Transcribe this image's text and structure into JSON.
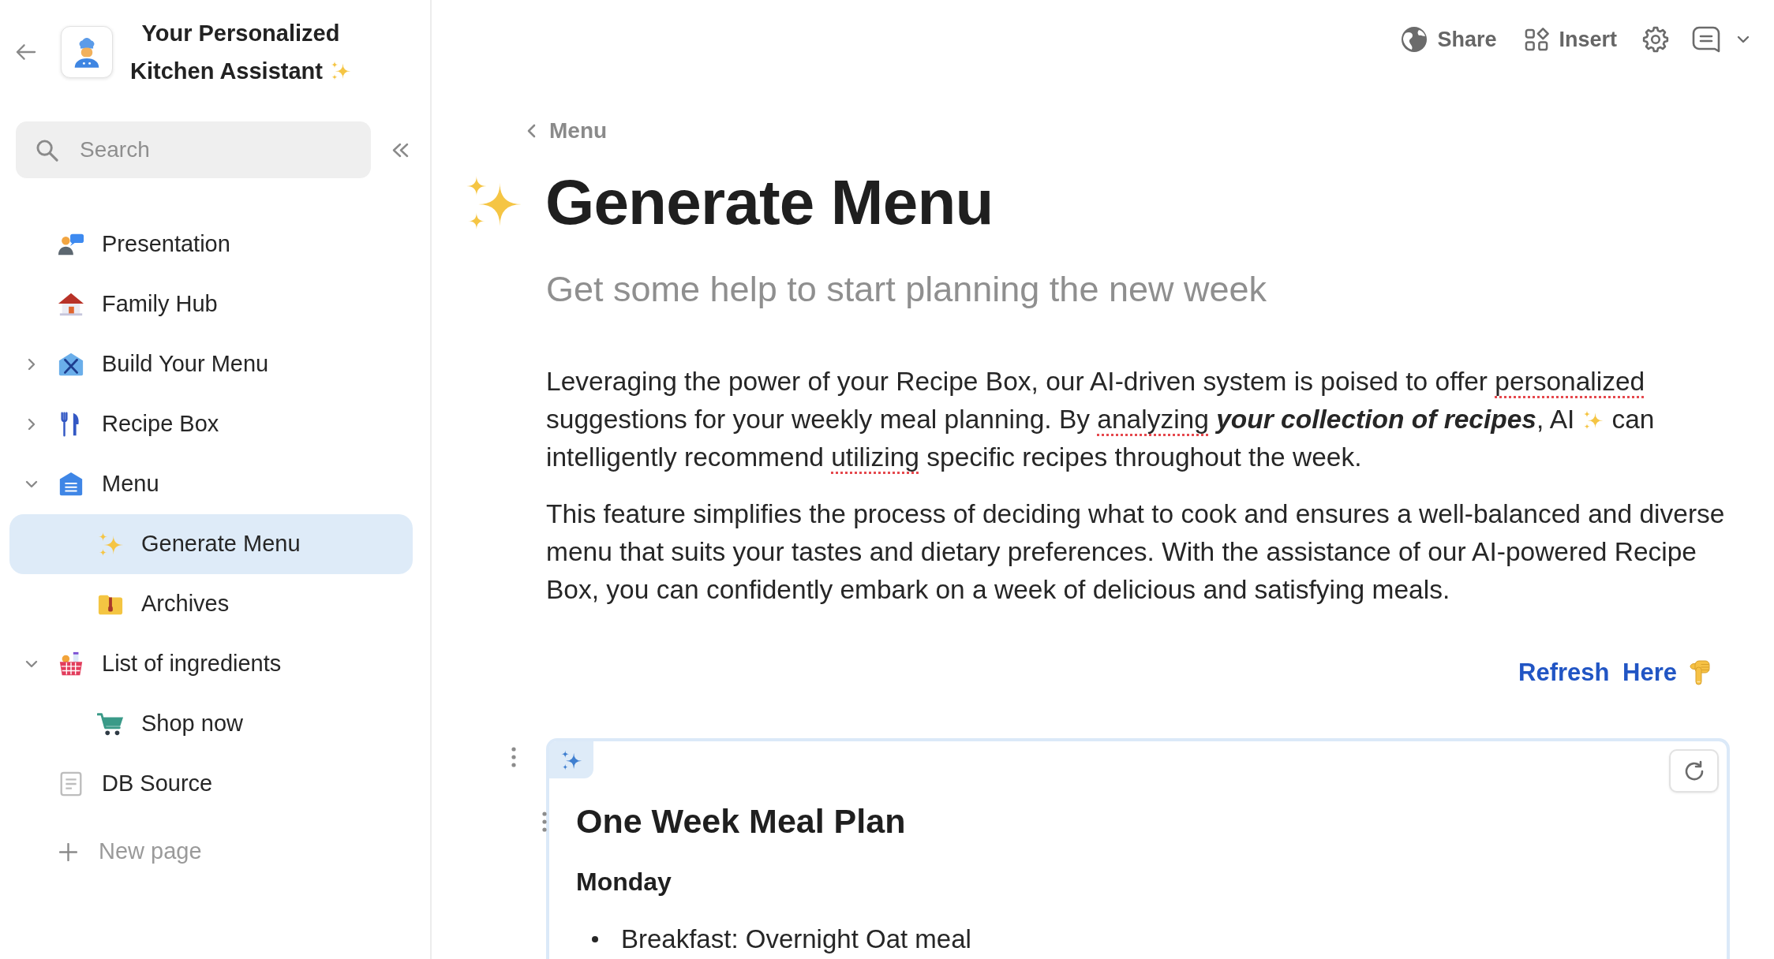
{
  "sidebar": {
    "title": "Your Personalized Kitchen Assistant",
    "search": {
      "placeholder": "Search"
    },
    "pages": [
      {
        "label": "Presentation",
        "selected": false
      },
      {
        "label": "Family Hub",
        "selected": false
      },
      {
        "label": "Build Your Menu",
        "expanded": false,
        "selected": false
      },
      {
        "label": "Recipe Box",
        "expanded": false,
        "selected": false
      },
      {
        "label": "Menu",
        "expanded": true,
        "selected": false,
        "children": [
          {
            "label": "Generate Menu",
            "selected": true
          },
          {
            "label": "Archives",
            "selected": false
          }
        ]
      },
      {
        "label": "List of ingredients",
        "expanded": true,
        "selected": false,
        "children": [
          {
            "label": "Shop now",
            "selected": false
          }
        ]
      },
      {
        "label": "DB Source",
        "selected": false
      }
    ],
    "new_page": "New page"
  },
  "toolbar": [
    {
      "label": "Share"
    },
    {
      "label": "Insert"
    }
  ],
  "breadcrumb": "Menu",
  "title": "Generate Menu",
  "subtitle": "Get some help to start planning the new week",
  "paragraphs": [
    {
      "segments": [
        [
          {
            "text": "Leveraging the power of your Recipe Box, our AI-driven system is poised to offer ",
            "emphasis": false,
            "spelling_error": false
          },
          {
            "text": "personalized",
            "emphasis": false,
            "spelling_error": true
          },
          {
            "text": " suggestions for your weekly meal planning. By ",
            "emphasis": false,
            "spelling_error": false
          },
          {
            "text": "analyzing",
            "emphasis": false,
            "spelling_error": true
          },
          {
            "text": " your collection of recipes",
            "emphasis": true,
            "spelling_error": false
          },
          {
            "text": ", AI",
            "emphasis": false,
            "spelling_error": false
          }
        ],
        [
          {
            "text": "can intelligently recommend ",
            "emphasis": false,
            "spelling_error": false
          },
          {
            "text": "utilizing",
            "emphasis": false,
            "spelling_error": true
          },
          {
            "text": " specific recipes throughout the week.",
            "emphasis": false,
            "spelling_error": false
          }
        ]
      ]
    },
    {
      "segments": [
        [
          {
            "text": "This feature simplifies the process of deciding what to cook and ensures a well-balanced and diverse menu that suits your tastes and dietary preferences. With the assistance of our AI-powered Recipe Box, you can confidently embark on a week of delicious and satisfying meals.",
            "emphasis": false,
            "spelling_error": false
          }
        ]
      ]
    }
  ],
  "refresh_link": "Refresh Here",
  "meal_plan": {
    "heading": "One Week Meal Plan",
    "days": [
      {
        "name": "Monday",
        "items": [
          "Breakfast: Overnight Oat meal"
        ]
      }
    ]
  }
}
